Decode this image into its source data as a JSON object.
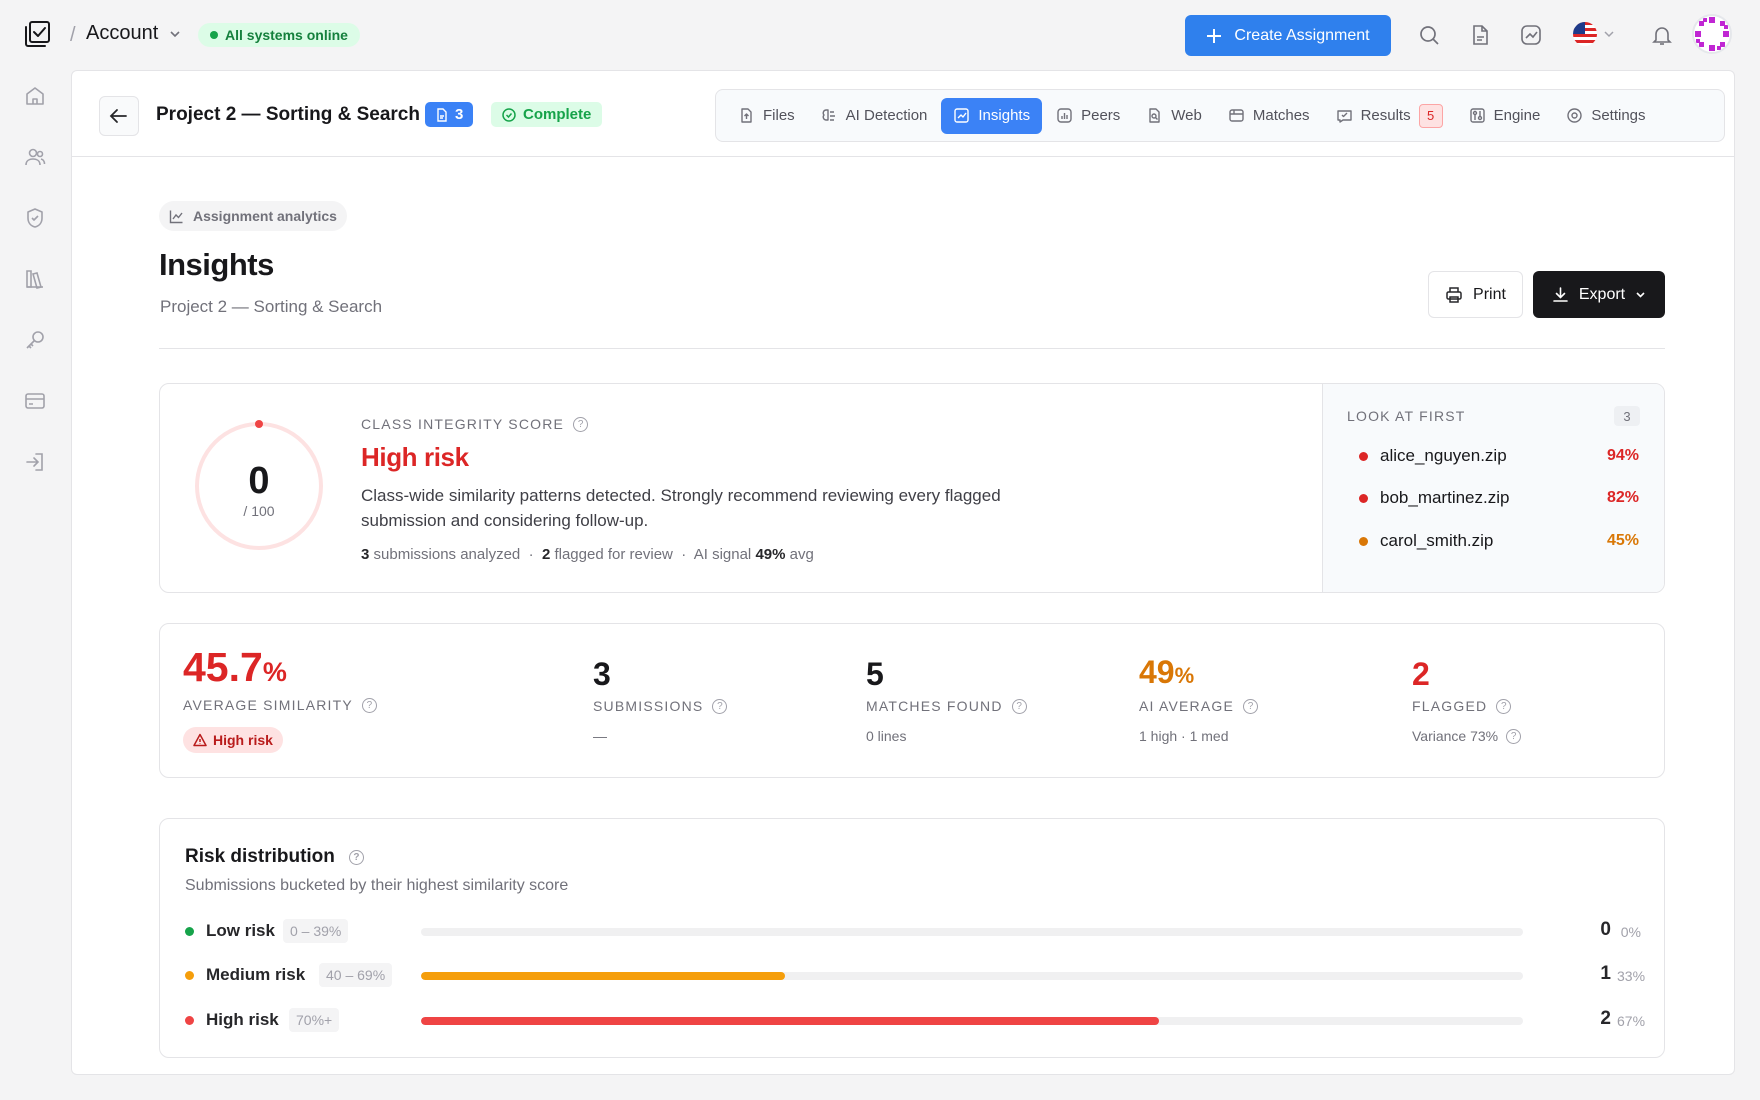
{
  "topbar": {
    "breadcrumb_sep": "/",
    "account_label": "Account",
    "status_text": "All systems online",
    "create_label": "Create Assignment"
  },
  "project": {
    "title": "Project 2 — Sorting & Search",
    "file_count": "3",
    "status": "Complete"
  },
  "tabs": [
    {
      "label": "Files",
      "icon": "file-upload-icon"
    },
    {
      "label": "AI Detection",
      "icon": "ai-brain-icon"
    },
    {
      "label": "Insights",
      "icon": "insights-icon",
      "active": true
    },
    {
      "label": "Peers",
      "icon": "peers-chart-icon"
    },
    {
      "label": "Web",
      "icon": "web-search-icon"
    },
    {
      "label": "Matches",
      "icon": "matches-icon"
    },
    {
      "label": "Results",
      "icon": "results-icon",
      "count": "5"
    },
    {
      "label": "Engine",
      "icon": "engine-icon"
    },
    {
      "label": "Settings",
      "icon": "settings-icon"
    }
  ],
  "header": {
    "chip": "Assignment analytics",
    "title": "Insights",
    "subtitle": "Project 2 — Sorting & Search",
    "print_label": "Print",
    "export_label": "Export"
  },
  "score": {
    "value": "0",
    "max": "/ 100",
    "fraction": 0,
    "label": "CLASS INTEGRITY SCORE",
    "risk": "High risk",
    "description": "Class-wide similarity patterns detected. Strongly recommend reviewing every flagged submission and considering follow-up.",
    "analyzed_count": "3",
    "analyzed_text": "submissions analyzed",
    "sep": "·",
    "flagged_count": "2",
    "flagged_text": "flagged for review",
    "ai_text": "AI signal",
    "ai_value": "49%",
    "ai_suffix": "avg"
  },
  "look_at_first": {
    "title": "LOOK AT FIRST",
    "count": "3",
    "items": [
      {
        "name": "alice_nguyen.zip",
        "pct": "94%",
        "color": "#dc2626"
      },
      {
        "name": "bob_martinez.zip",
        "pct": "82%",
        "color": "#dc2626"
      },
      {
        "name": "carol_smith.zip",
        "pct": "45%",
        "color": "#d97706"
      }
    ]
  },
  "stats": {
    "avg_similarity": {
      "value": "45.7",
      "unit": "%",
      "label": "AVERAGE SIMILARITY",
      "badge": "High risk"
    },
    "submissions": {
      "value": "3",
      "label": "SUBMISSIONS",
      "sub": "—"
    },
    "matches": {
      "value": "5",
      "label": "MATCHES FOUND",
      "sub": "0 lines"
    },
    "ai_average": {
      "value": "49",
      "unit": "%",
      "label": "AI AVERAGE",
      "sub": "1 high · 1 med"
    },
    "flagged": {
      "value": "2",
      "label": "FLAGGED",
      "sub": "Variance 73%"
    }
  },
  "distribution": {
    "title": "Risk distribution",
    "subtitle": "Submissions bucketed by their highest similarity score",
    "rows": [
      {
        "name": "Low risk",
        "range": "0 – 39%",
        "count": "0",
        "pct": "0%",
        "fraction": 0,
        "color": "#16a34a"
      },
      {
        "name": "Medium risk",
        "range": "40 – 69%",
        "count": "1",
        "pct": "33%",
        "fraction": 0.33,
        "color": "#f59e0b"
      },
      {
        "name": "High risk",
        "range": "70%+",
        "count": "2",
        "pct": "67%",
        "fraction": 0.67,
        "color": "#ef4444"
      }
    ]
  },
  "colors": {
    "accent": "#2f80ed",
    "danger": "#dc2626",
    "warning": "#d97706",
    "success": "#16a34a"
  }
}
